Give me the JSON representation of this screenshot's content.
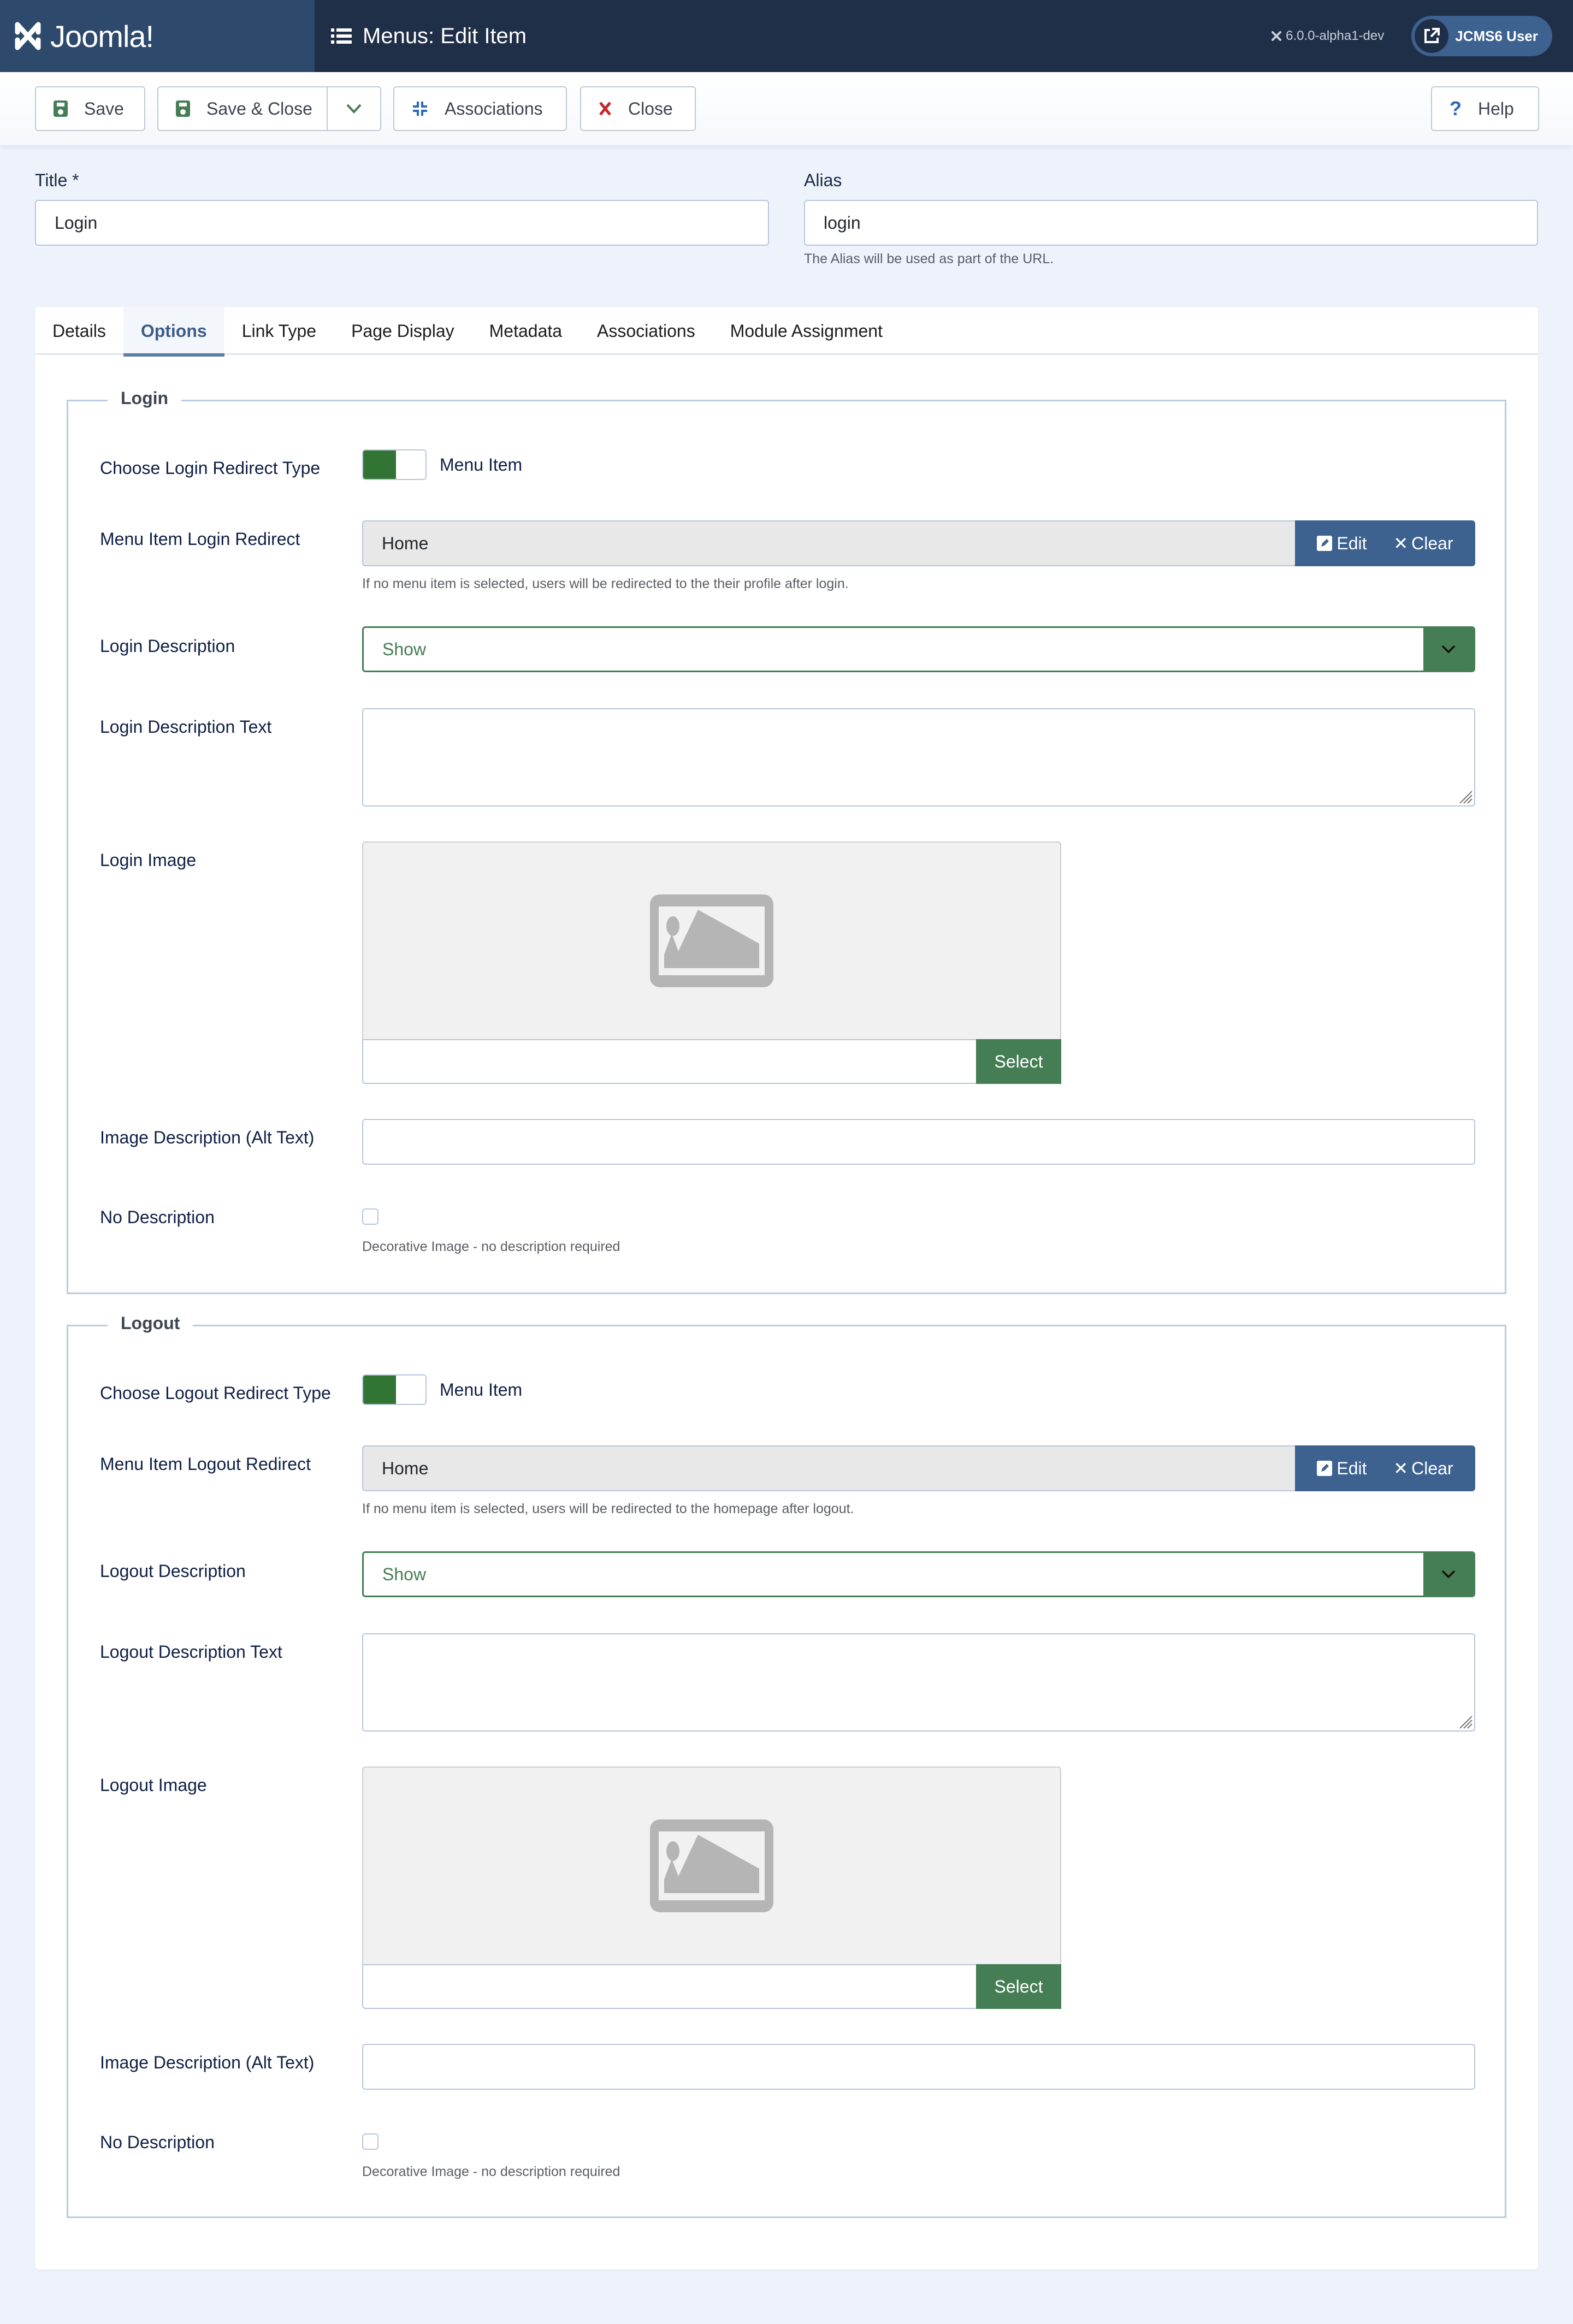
{
  "header": {
    "brand": "Joomla!",
    "title": "Menus: Edit Item",
    "version": "6.0.0-alpha1-dev",
    "user": "JCMS6 User"
  },
  "toolbar": {
    "save": "Save",
    "save_close": "Save & Close",
    "associations": "Associations",
    "close": "Close",
    "help": "Help"
  },
  "form": {
    "title_label": "Title *",
    "title_value": "Login",
    "alias_label": "Alias",
    "alias_value": "login",
    "alias_help": "The Alias will be used as part of the URL."
  },
  "tabs": [
    {
      "label": "Details",
      "active": false
    },
    {
      "label": "Options",
      "active": true
    },
    {
      "label": "Link Type",
      "active": false
    },
    {
      "label": "Page Display",
      "active": false
    },
    {
      "label": "Metadata",
      "active": false
    },
    {
      "label": "Associations",
      "active": false
    },
    {
      "label": "Module Assignment",
      "active": false
    }
  ],
  "login": {
    "legend": "Login",
    "redirect_type_label": "Choose Login Redirect Type",
    "redirect_type_value": "Menu Item",
    "redirect_label": "Menu Item Login Redirect",
    "redirect_value": "Home",
    "edit": "Edit",
    "clear": "Clear",
    "redirect_help": "If no menu item is selected, users will be redirected to the their profile after login.",
    "description_label": "Login Description",
    "description_value": "Show",
    "description_text_label": "Login Description Text",
    "description_text_value": "",
    "image_label": "Login Image",
    "image_select": "Select",
    "image_path": "",
    "alt_label": "Image Description (Alt Text)",
    "alt_value": "",
    "no_desc_label": "No Description",
    "no_desc_checked": false,
    "no_desc_help": "Decorative Image - no description required"
  },
  "logout": {
    "legend": "Logout",
    "redirect_type_label": "Choose Logout Redirect Type",
    "redirect_type_value": "Menu Item",
    "redirect_label": "Menu Item Logout Redirect",
    "redirect_value": "Home",
    "edit": "Edit",
    "clear": "Clear",
    "redirect_help": "If no menu item is selected, users will be redirected to the homepage after logout.",
    "description_label": "Logout Description",
    "description_value": "Show",
    "description_text_label": "Logout Description Text",
    "description_text_value": "",
    "image_label": "Logout Image",
    "image_select": "Select",
    "image_path": "",
    "alt_label": "Image Description (Alt Text)",
    "alt_value": "",
    "no_desc_label": "No Description",
    "no_desc_checked": false,
    "no_desc_help": "Decorative Image - no description required"
  },
  "colors": {
    "header_bg": "#202f48",
    "brand_bg": "#2d4a6d",
    "primary": "#3d6290",
    "success": "#457d54",
    "switch_on": "#317434",
    "danger": "#c52727"
  }
}
